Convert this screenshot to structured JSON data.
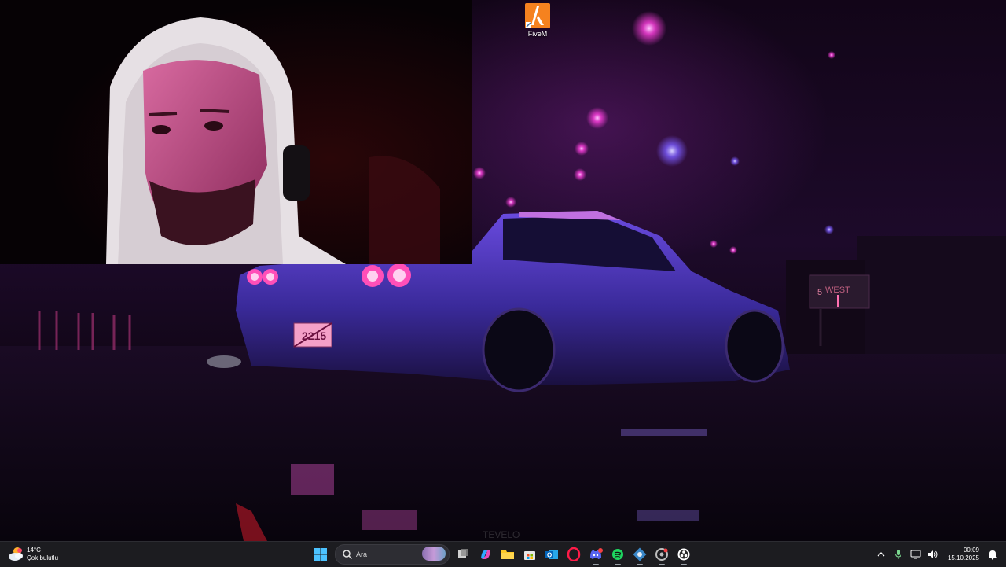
{
  "desktop": {
    "icons": [
      {
        "label": "FiveM",
        "icon": "fivem-icon"
      }
    ],
    "wallpaper_watermark": "TEVELO",
    "license_plate": "2215"
  },
  "taskbar": {
    "weather": {
      "temperature": "14°C",
      "condition": "Çok bulutlu",
      "icon": "cloud-sun-icon"
    },
    "search": {
      "placeholder": "Ara"
    },
    "apps": [
      "start-button",
      "search-box",
      "task-view",
      "copilot",
      "file-explorer",
      "microsoft-store",
      "outlook",
      "opera-gx",
      "discord",
      "spotify",
      "steam",
      "chrome",
      "obs-studio"
    ],
    "tray": {
      "icons": [
        "chevron-up-icon",
        "microphone-icon",
        "network-icon",
        "speaker-icon",
        "notification-icon"
      ]
    },
    "clock": {
      "time": "00:09",
      "date": "15.10.2025"
    }
  },
  "colors": {
    "taskbar_bg": "#1c1c20",
    "neon_pink": "#ff3fd8",
    "neon_purple": "#7b5cff"
  }
}
